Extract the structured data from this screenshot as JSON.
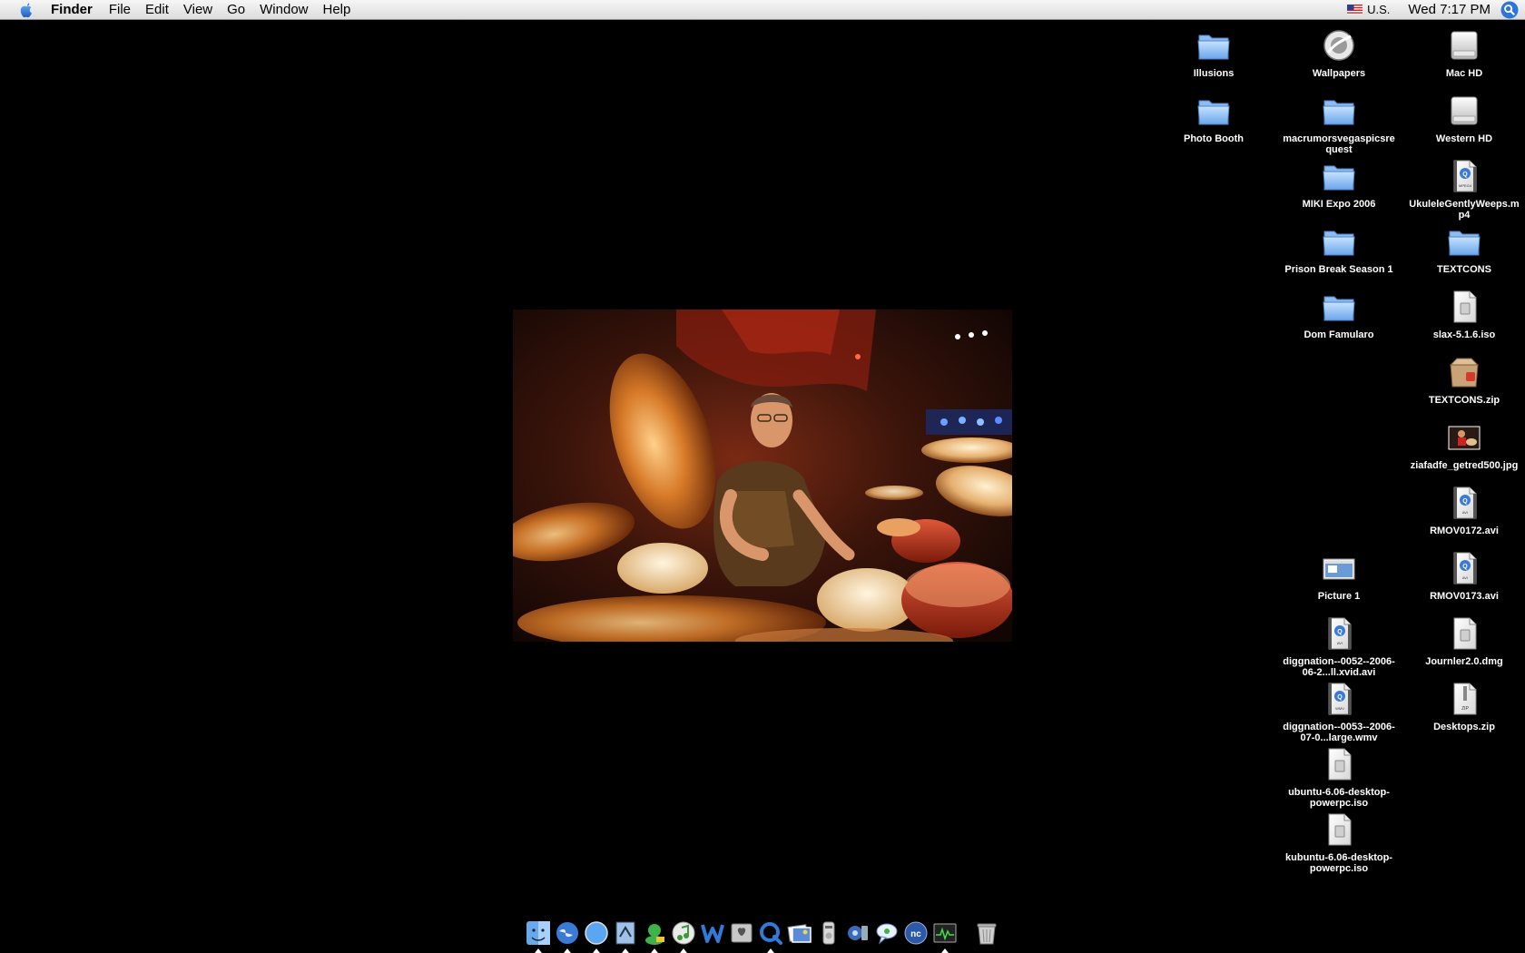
{
  "menubar": {
    "app_name": "Finder",
    "menus": [
      "File",
      "Edit",
      "View",
      "Go",
      "Window",
      "Help"
    ],
    "input_menu": "U.S.",
    "clock": "Wed 7:17 PM"
  },
  "desktop_icons": [
    {
      "label": "Illusions",
      "kind": "folder"
    },
    {
      "label": "Wallpapers",
      "kind": "globe"
    },
    {
      "label": "Mac HD",
      "kind": "drive"
    },
    {
      "label": "Photo Booth",
      "kind": "folder"
    },
    {
      "label": "macrumorsvegaspicsrequest",
      "kind": "folder"
    },
    {
      "label": "Western HD",
      "kind": "drive"
    },
    {
      "label": "MIKI Expo 2006",
      "kind": "folder"
    },
    {
      "label": "UkuleleGentlyWeeps.mp4",
      "kind": "movie",
      "badge": "MPEG4"
    },
    {
      "label": "Prison Break Season 1",
      "kind": "folder"
    },
    {
      "label": "TEXTCONS",
      "kind": "folder"
    },
    {
      "label": "Dom Famularo",
      "kind": "folder"
    },
    {
      "label": "slax-5.1.6.iso",
      "kind": "disk-image"
    },
    {
      "label": "TEXTCONS.zip",
      "kind": "archive"
    },
    {
      "label": "ziafadfe_getred500.jpg",
      "kind": "photo"
    },
    {
      "label": "RMOV0172.avi",
      "kind": "movie",
      "badge": "AVI"
    },
    {
      "label": "Picture 1",
      "kind": "screenshot"
    },
    {
      "label": "RMOV0173.avi",
      "kind": "movie",
      "badge": "AVI"
    },
    {
      "label": "diggnation--0052--2006-06-2...ll.xvid.avi",
      "kind": "movie",
      "badge": "AVI"
    },
    {
      "label": "Journler2.0.dmg",
      "kind": "disk-image"
    },
    {
      "label": "diggnation--0053--2006-07-0...large.wmv",
      "kind": "movie",
      "badge": "WMV"
    },
    {
      "label": "Desktops.zip",
      "kind": "zip",
      "badge": "ZIP"
    },
    {
      "label": "ubuntu-6.06-desktop-powerpc.iso",
      "kind": "disk-image"
    },
    {
      "label": "kubuntu-6.06-desktop-powerpc.iso",
      "kind": "disk-image"
    }
  ],
  "dock_items": [
    {
      "name": "finder",
      "running": true
    },
    {
      "name": "camino",
      "running": true
    },
    {
      "name": "safari",
      "running": true
    },
    {
      "name": "mail",
      "running": true
    },
    {
      "name": "adium",
      "running": true
    },
    {
      "name": "itunes",
      "running": true
    },
    {
      "name": "word",
      "running": false
    },
    {
      "name": "system-preferences",
      "running": false
    },
    {
      "name": "quicktime",
      "running": true
    },
    {
      "name": "iphoto",
      "running": false
    },
    {
      "name": "dvd-player",
      "running": false
    },
    {
      "name": "network-utility",
      "running": false
    },
    {
      "name": "ichat",
      "running": false
    },
    {
      "name": "nc",
      "running": false
    },
    {
      "name": "activity-monitor",
      "running": true
    },
    {
      "name": "trash",
      "running": false
    }
  ]
}
